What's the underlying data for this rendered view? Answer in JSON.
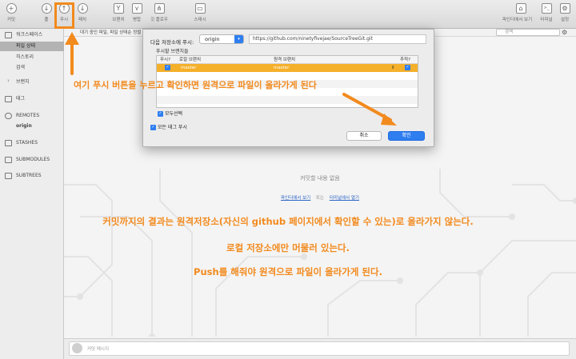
{
  "toolbar": {
    "buttons": [
      {
        "label": "커밋",
        "icon": "+"
      },
      {
        "label": "풀",
        "icon": "↓"
      },
      {
        "label": "푸시",
        "icon": "↑"
      },
      {
        "label": "패치",
        "icon": "↓"
      },
      {
        "label": "브랜치",
        "icon": "Y"
      },
      {
        "label": "병합",
        "icon": "⋎"
      },
      {
        "label": "깃 플로우",
        "icon": "⋔"
      },
      {
        "label": "스태시",
        "icon": "▭"
      }
    ],
    "right_buttons": [
      {
        "label": "파인더에서 보기",
        "icon": "⌂"
      },
      {
        "label": "터미널",
        "icon": ">_"
      },
      {
        "label": "설정",
        "icon": "⚙"
      }
    ]
  },
  "sidebar": {
    "workspace": "워크스페이스",
    "file_status": "파일 상태",
    "history": "히스토리",
    "search": "검색",
    "branches": "브랜치",
    "tags": "태그",
    "remotes": "REMOTES",
    "origin": "origin",
    "stashes": "STASHES",
    "submodules": "SUBMODULES",
    "subtrees": "SUBTREES"
  },
  "main": {
    "status_text": "대기 중인 파일, 파일 상태순 정렬",
    "search_placeholder": "검색",
    "empty_message": "커밋할 내용 없음",
    "link_finder": "파인더에서 보기",
    "link_or": "또는",
    "link_terminal": "터미널에서 열기",
    "commit_placeholder": "커밋 메시지"
  },
  "dialog": {
    "push_to_label": "다음 저장소에 푸시:",
    "remote": "origin",
    "remote_url": "https://github.com/ninetyfivejae/SourceTreeGit.git",
    "branches_label": "푸시할 브랜치들",
    "columns": {
      "push": "푸시?",
      "local": "로컬 브랜치",
      "remote": "원격 브랜치",
      "track": "추적?"
    },
    "rows": [
      {
        "local": "master",
        "remote": "master"
      }
    ],
    "select_all": "모두선택",
    "push_all_tags": "모든 태그 푸시",
    "cancel": "취소",
    "ok": "확인"
  },
  "annotations": {
    "instruction": "여기 푸시 버튼을 누르고 확인하면 원격으로 파일이 올라가게 된다",
    "note1": "커밋까지의 결과는 원격저장소(자신의 github 페이지에서 확인할 수 있는)로 올라가지 않는다.",
    "note2": "로컬 저장소에만 머물러 있는다.",
    "note3": "Push를 해줘야 원격으로 파일이 올라가게 된다."
  },
  "colors": {
    "accent": "#2f7ef0",
    "annotation": "#f28a1e",
    "selected_row": "#f5b02a"
  }
}
